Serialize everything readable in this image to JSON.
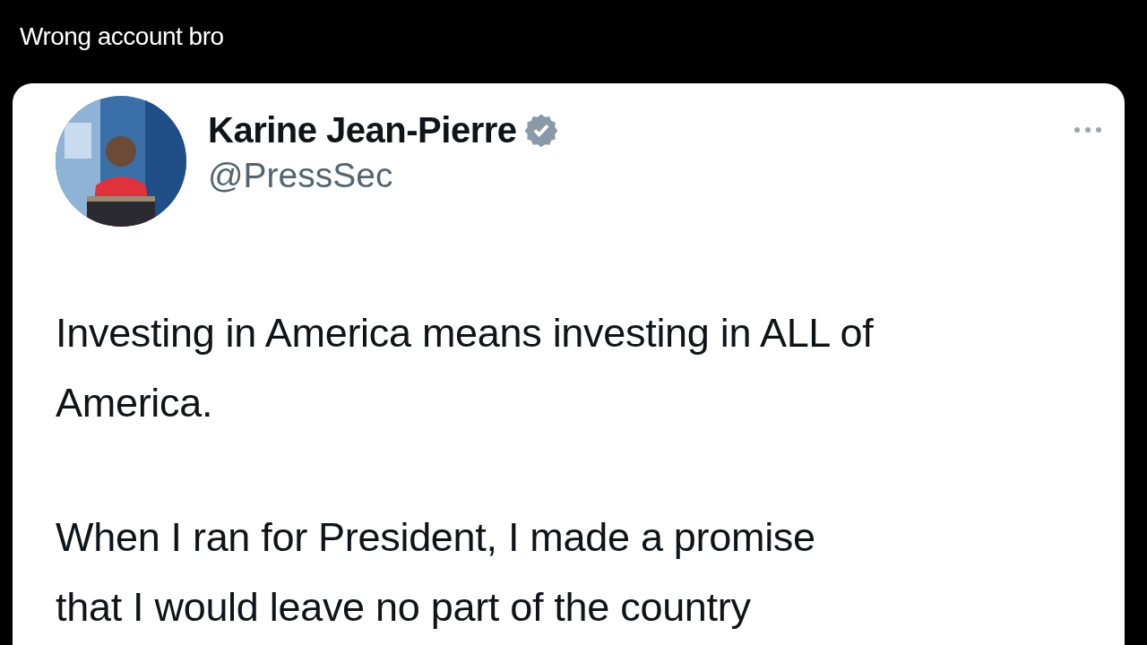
{
  "caption": "Wrong account bro",
  "tweet": {
    "author": {
      "name": "Karine Jean-Pierre",
      "verified": true,
      "handle": "@PressSec"
    },
    "paragraphs": [
      {
        "lines": [
          "Investing in America means investing in ALL of",
          "America."
        ]
      },
      {
        "lines": [
          "When I ran for President, I made a promise",
          "that I would leave no part of the country"
        ]
      }
    ]
  }
}
